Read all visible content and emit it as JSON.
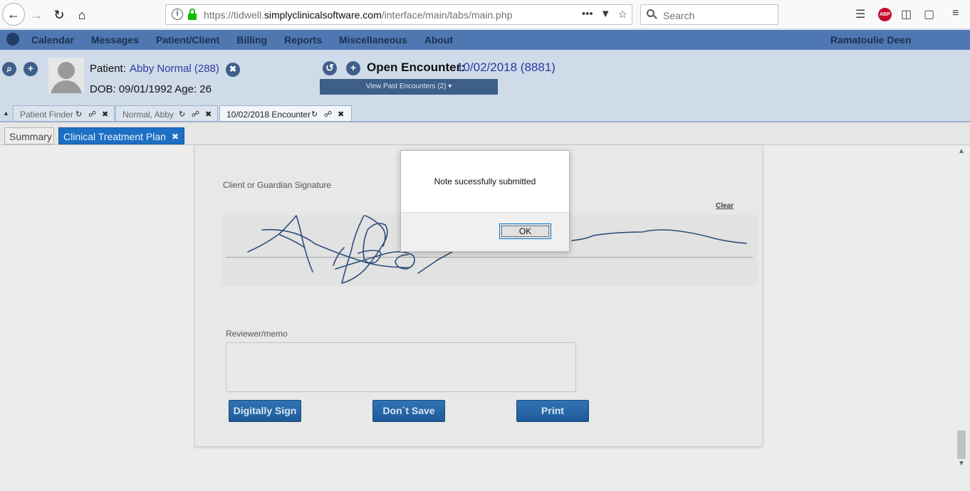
{
  "browser": {
    "url_prefix": "https://tidwell.",
    "url_host": "simplyclinicalsoftware.com",
    "url_path": "/interface/main/tabs/main.php",
    "search_placeholder": "Search",
    "adblock_label": "ABP",
    "url_more_glyph": "•••",
    "icons": [
      "back-arrow-icon",
      "forward-arrow-icon",
      "reload-icon",
      "home-icon",
      "info-icon",
      "lock-icon",
      "pocket-icon",
      "bookmark-star-icon",
      "library-icon",
      "adblock-icon",
      "sidebar-icon",
      "container-icon",
      "hamburger-menu-icon"
    ]
  },
  "app_nav": {
    "items": [
      "Calendar",
      "Messages",
      "Patient/Client",
      "Billing",
      "Reports",
      "Miscellaneous",
      "About"
    ],
    "user": "Ramatoulie Deen"
  },
  "patient": {
    "label": "Patient:",
    "name": "Abby Normal (288)",
    "dob_line": "DOB: 09/01/1992 Age: 26"
  },
  "encounter": {
    "label": "Open Encounter:",
    "value": "10/02/2018 (8881)",
    "past_label": "View Past Encounters  (2) ▾"
  },
  "tabs": [
    {
      "label": "Patient Finder"
    },
    {
      "label": "Normal, Abby"
    },
    {
      "label": "10/02/2018 Encounter"
    }
  ],
  "subtabs": {
    "summary": "Summary",
    "ctp": "Clinical Treatment Plan"
  },
  "form": {
    "signature_label": "Client or Guardian Signature",
    "clear_label": "Clear",
    "memo_label": "Reviewer/memo",
    "memo_value": "",
    "sign_button": "Digitally Sign",
    "dont_save_button": "Don`t Save",
    "print_button": "Print"
  },
  "dialog": {
    "message": "Note sucessfully submitted",
    "ok_label": "OK"
  },
  "colors": {
    "app_nav_bg": "#4f78b3",
    "header_bg": "#cfdbe8",
    "accent_blue": "#1c6fc2",
    "link_blue": "#2b3aa3"
  }
}
